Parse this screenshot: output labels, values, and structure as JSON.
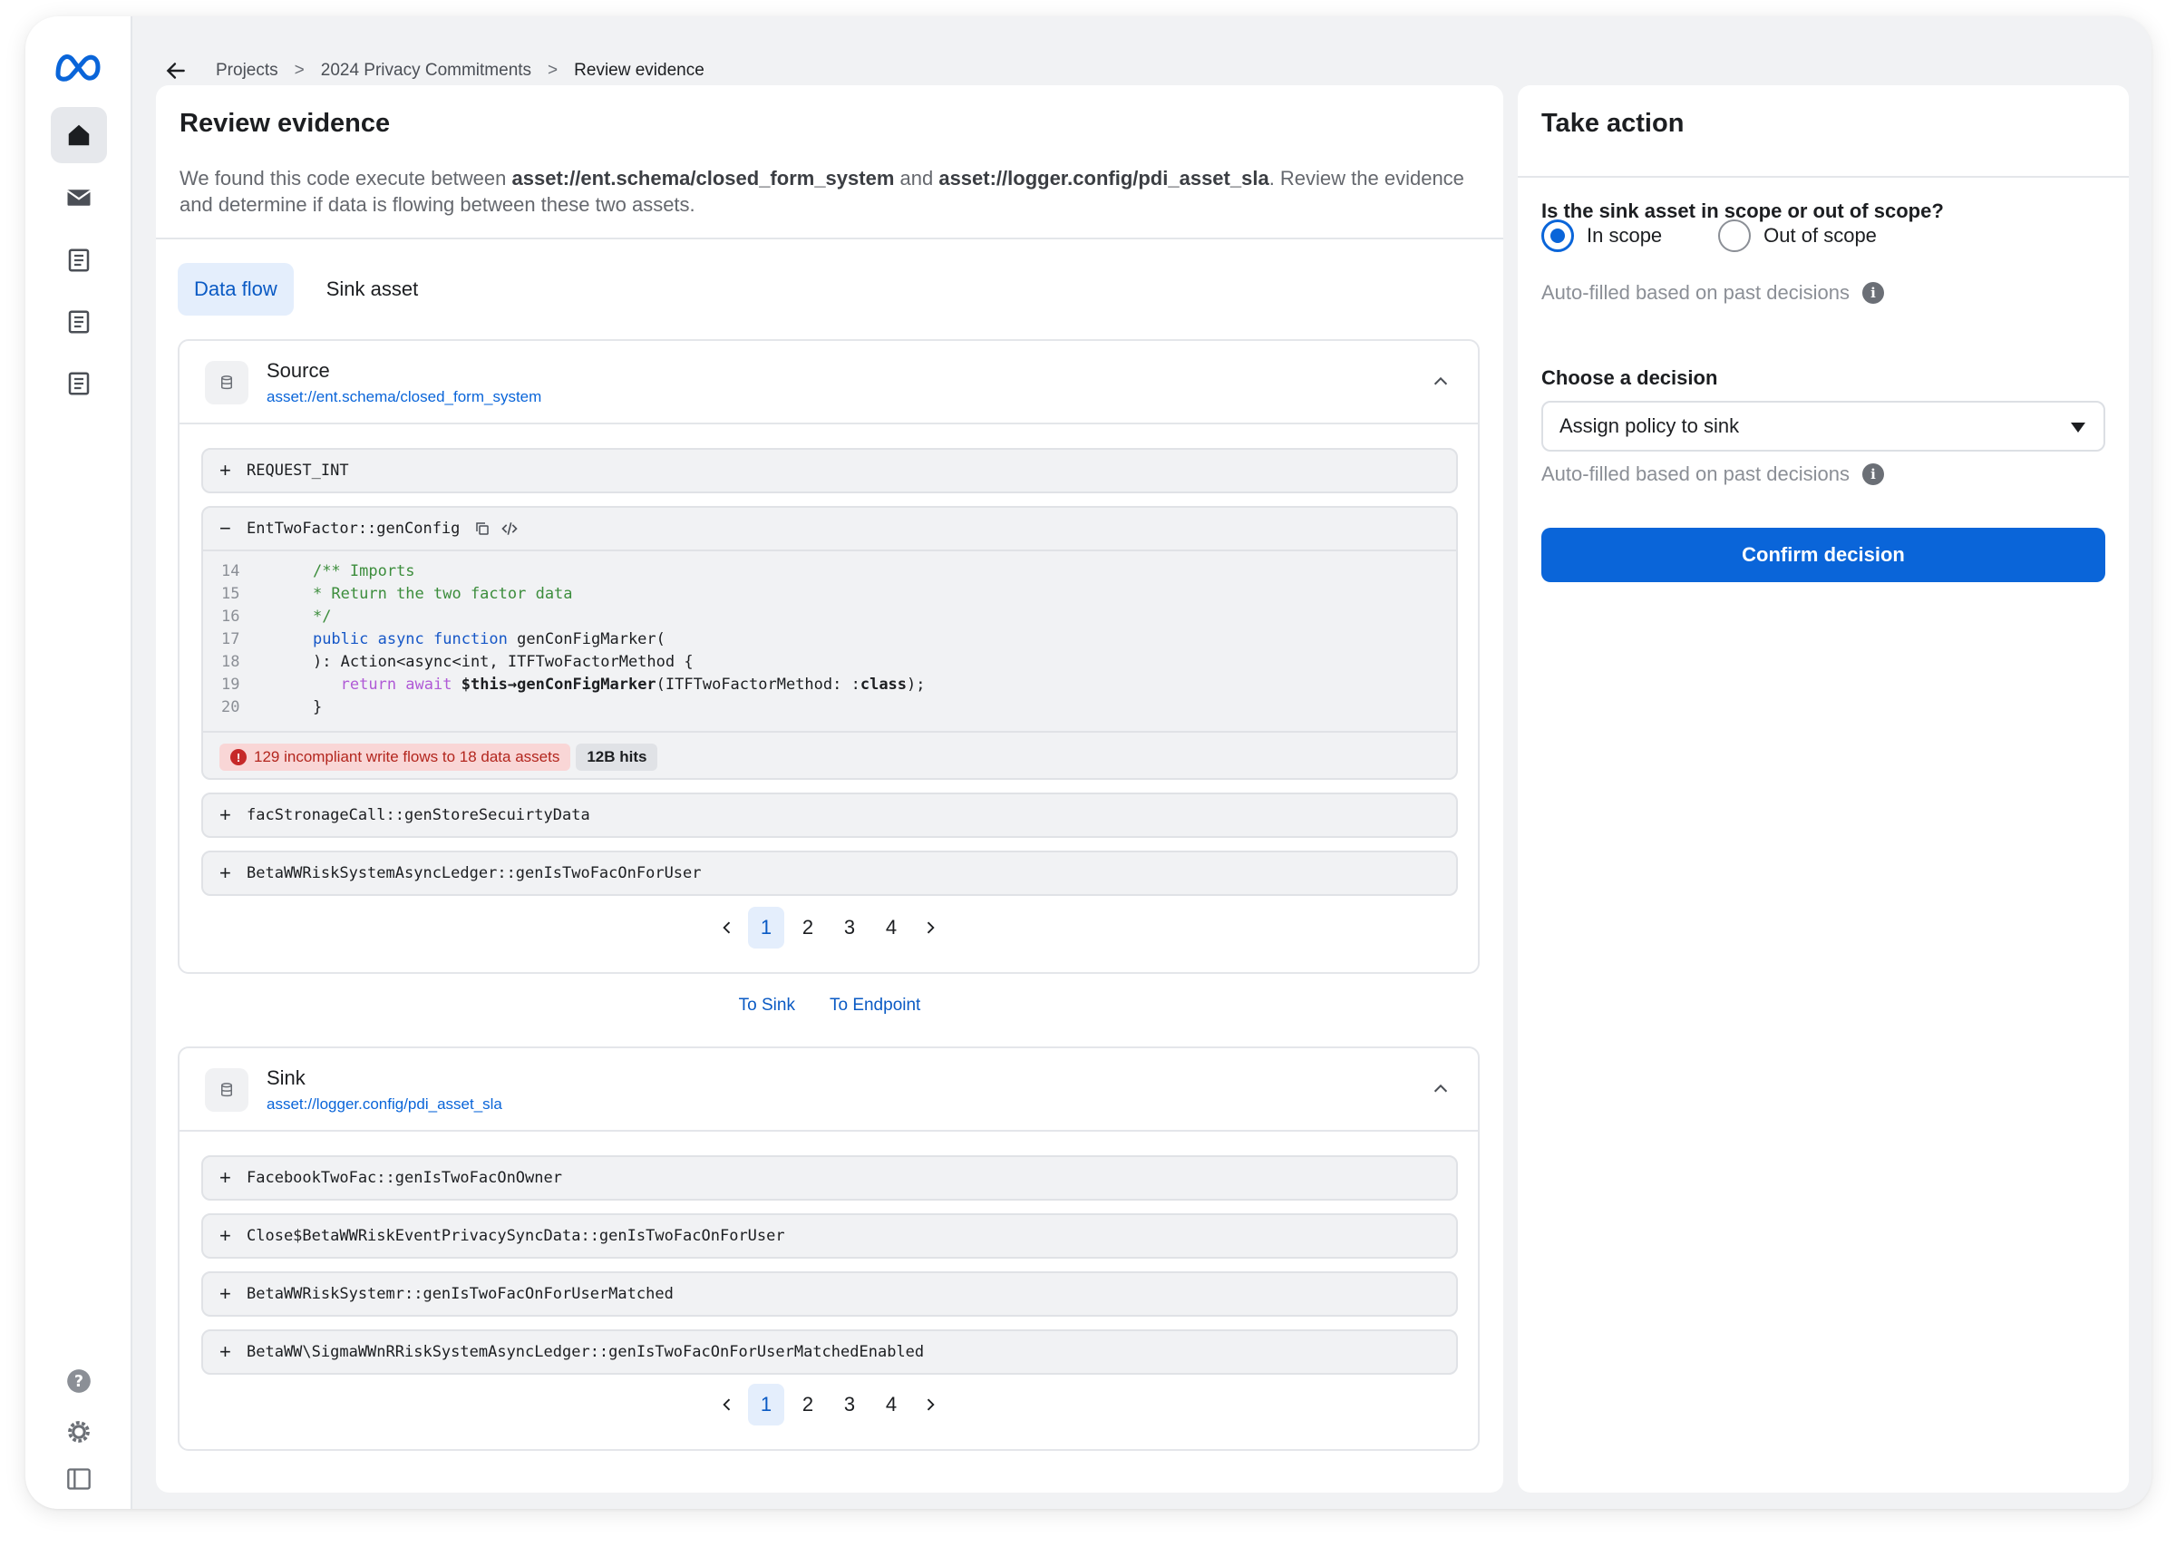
{
  "breadcrumb": {
    "items": [
      "Projects",
      "2024 Privacy Commitments",
      "Review evidence"
    ],
    "separator": ">"
  },
  "review": {
    "title": "Review evidence",
    "desc_prefix": "We found this code execute between ",
    "asset_a": "asset://ent.schema/closed_form_system",
    "desc_mid": " and ",
    "asset_b": "asset://logger.config/pdi_asset_sla",
    "desc_suffix": ". Review the evidence and determine if data is flowing between these two assets."
  },
  "tabs": [
    "Data flow",
    "Sink asset"
  ],
  "source": {
    "title": "Source",
    "asset": "asset://ent.schema/closed_form_system",
    "rows": [
      "REQUEST_INT"
    ],
    "expanded_row": "EntTwoFactor::genConfig",
    "code_line_numbers": [
      "14",
      "15",
      "16",
      "17",
      "18",
      "19",
      "20"
    ],
    "code": {
      "l14": "/** Imports",
      "l15": "* Return the two factor data",
      "l16": "*/",
      "l17_kw": "public async function",
      "l17_rest": " genConFigMarker(",
      "l18": "): Action<async<int, ITFTwoFactorMethod {",
      "l19_kw": "return await",
      "l19_this": "$this→genConFigMarker",
      "l19_args": "(ITFTwoFactorMethod: :",
      "l19_class": "class",
      "l19_end": ");",
      "l20": "}"
    },
    "badge_warning": "129 incompliant write flows to 18 data assets",
    "badge_hits": "12B hits",
    "rows_after": [
      "facStronageCall::genStoreSecuirtyData",
      "BetaWWRiskSystemAsyncLedger::genIsTwoFacOnForUser"
    ],
    "pages": [
      "1",
      "2",
      "3",
      "4"
    ]
  },
  "links": [
    "To Sink",
    "To Endpoint"
  ],
  "sink": {
    "title": "Sink",
    "asset": "asset://logger.config/pdi_asset_sla",
    "rows": [
      "FacebookTwoFac::genIsTwoFacOnOwner",
      "Close$BetaWWRiskEventPrivacySyncData::genIsTwoFacOnForUser",
      "BetaWWRiskSystemr::genIsTwoFacOnForUserMatched",
      "BetaWW\\SigmaWWnRRiskSystemAsyncLedger::genIsTwoFacOnForUserMatchedEnabled"
    ],
    "pages": [
      "1",
      "2",
      "3",
      "4"
    ]
  },
  "action": {
    "title": "Take action",
    "scope_question": "Is the sink asset in scope or out of scope?",
    "scope_options": [
      "In scope",
      "Out of scope"
    ],
    "selected_scope": "In scope",
    "autofill_hint": "Auto-filled based on past decisions",
    "decision_label": "Choose a decision",
    "decision_value": "Assign policy to sink",
    "confirm_label": "Confirm decision"
  },
  "colors": {
    "accent": "#0a65d9",
    "danger_bg": "#f9d6d6",
    "danger_text": "#b3261e",
    "code_comment": "#3c8d3c",
    "code_keyword": "#1657c7",
    "code_keyword2": "#b05ad6"
  },
  "icons": {
    "logo": "meta-logo",
    "nav": [
      "home-icon",
      "mail-icon",
      "document-icon",
      "document-icon",
      "document-icon"
    ],
    "bottom": [
      "help-icon",
      "settings-icon",
      "sidebar-toggle-icon"
    ]
  }
}
